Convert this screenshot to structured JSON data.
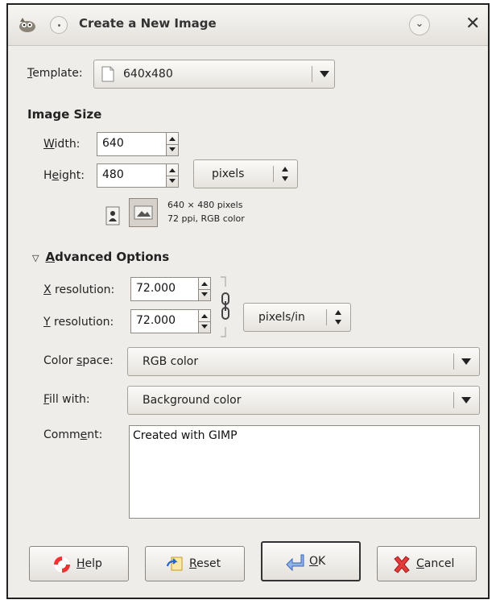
{
  "window": {
    "title": "Create a New Image"
  },
  "template": {
    "label": "Template:",
    "value": "640x480"
  },
  "image_size": {
    "heading": "Image Size",
    "width_label": "Width:",
    "width_value": "640",
    "height_label": "Height:",
    "height_value": "480",
    "unit": "pixels",
    "info_line1": "640 × 480 pixels",
    "info_line2": "72 ppi, RGB color"
  },
  "advanced": {
    "heading": "Advanced Options",
    "x_res_label": "X resolution:",
    "x_res_value": "72.000",
    "y_res_label": "Y resolution:",
    "y_res_value": "72.000",
    "res_unit": "pixels/in",
    "color_space_label": "Color space:",
    "color_space_value": "RGB color",
    "fill_label": "Fill with:",
    "fill_value": "Background color",
    "comment_label": "Comment:",
    "comment_value": "Created with GIMP"
  },
  "buttons": {
    "help": "Help",
    "reset": "Reset",
    "ok": "OK",
    "cancel": "Cancel"
  },
  "icons": {
    "app": "gimp-wilber-icon",
    "pin": "pin-icon",
    "menu": "chevron-down-icon",
    "close": "close-icon",
    "template": "document-icon",
    "portrait": "portrait-icon",
    "landscape": "landscape-icon",
    "chain": "chain-link-icon",
    "help": "lifebuoy-icon",
    "reset": "reset-icon",
    "ok": "ok-arrow-icon",
    "cancel": "cancel-x-icon"
  }
}
